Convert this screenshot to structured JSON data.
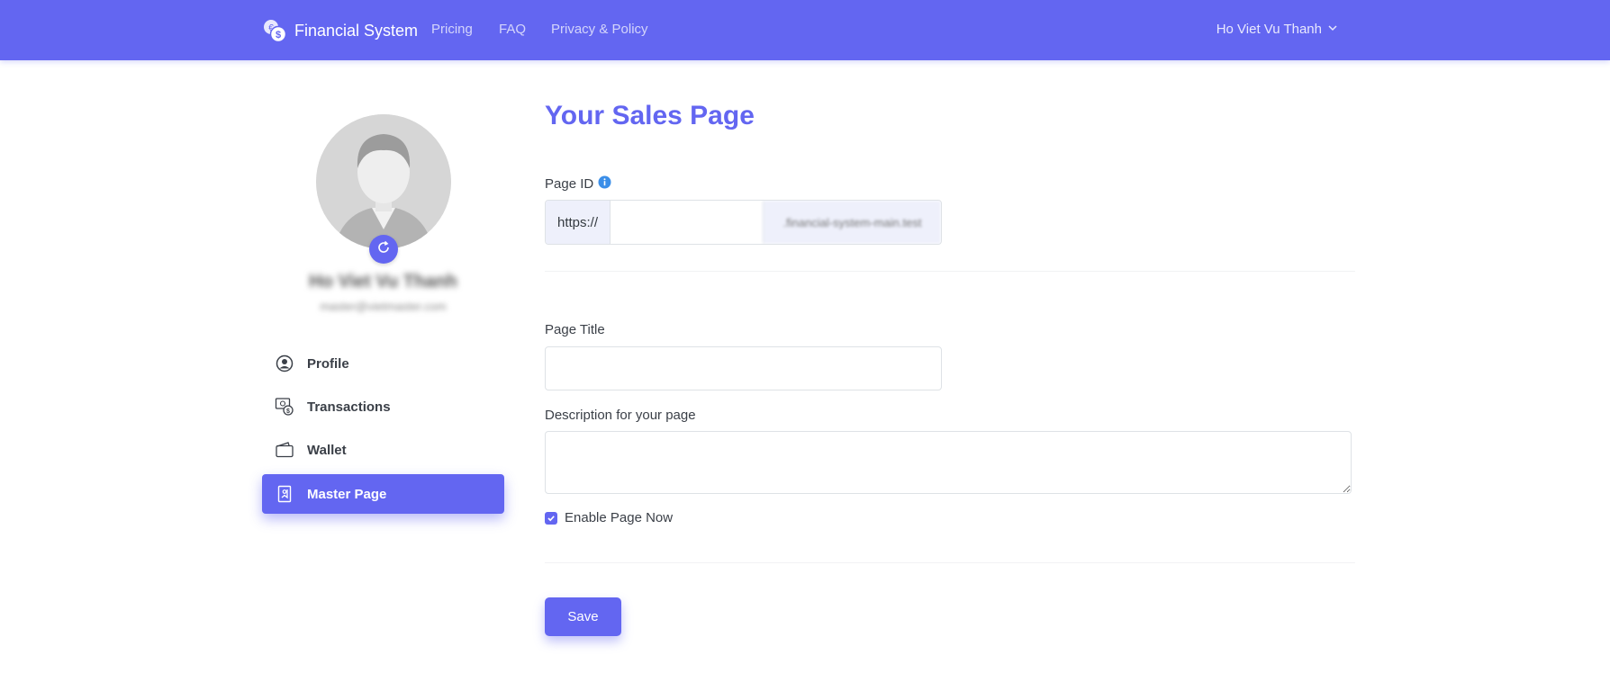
{
  "header": {
    "brand": "Financial System",
    "nav": [
      "Pricing",
      "FAQ",
      "Privacy & Policy"
    ],
    "user_menu": "Ho Viet Vu Thanh"
  },
  "profile": {
    "name": "Ho Viet Vu Thanh",
    "email": "master@vietmaster.com"
  },
  "sidebar": {
    "items": [
      {
        "label": "Profile",
        "icon": "user-circle-icon",
        "active": false
      },
      {
        "label": "Transactions",
        "icon": "money-exchange-icon",
        "active": false
      },
      {
        "label": "Wallet",
        "icon": "wallet-icon",
        "active": false
      },
      {
        "label": "Master Page",
        "icon": "bookmark-page-icon",
        "active": true
      }
    ]
  },
  "main": {
    "title": "Your Sales Page",
    "page_id_label": "Page ID",
    "page_id_prefix": "https://",
    "page_id_value": "",
    "page_id_suffix": ".financial-system-main.test",
    "page_title_label": "Page Title",
    "page_title_value": "",
    "description_label": "Description for your page",
    "description_value": "",
    "enable_label": "Enable Page Now",
    "enable_checked": true,
    "save_label": "Save"
  },
  "colors": {
    "accent": "#6366f1",
    "info_icon": "#3b8ee8"
  }
}
